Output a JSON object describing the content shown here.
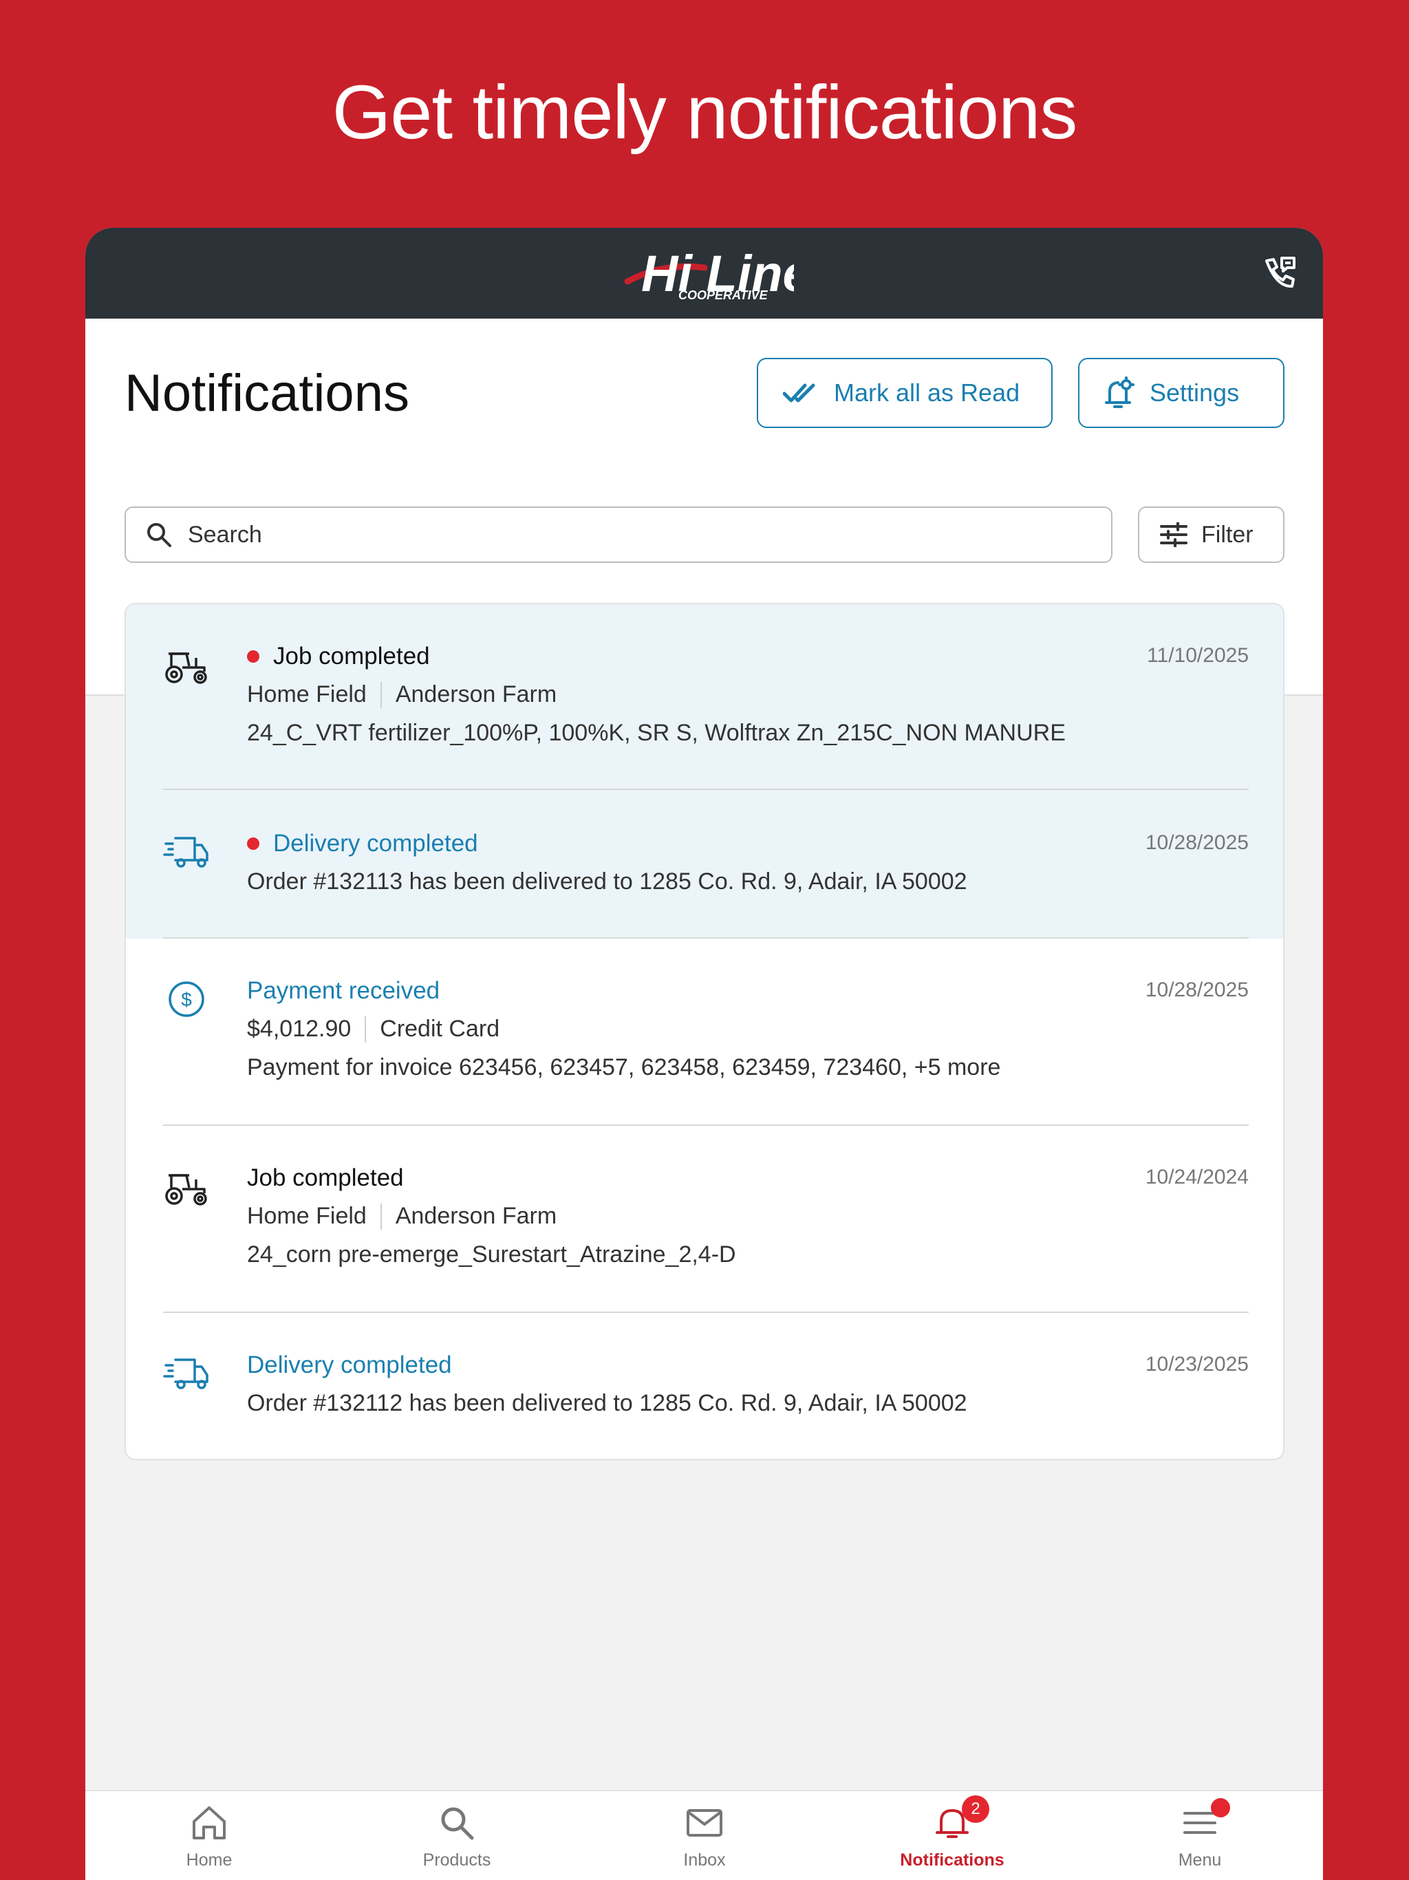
{
  "hero": {
    "headline": "Get timely notifications"
  },
  "header": {
    "logo_text": "Hi Line",
    "logo_subtext": "COOPERATIVE"
  },
  "page": {
    "title": "Notifications",
    "mark_all_label": "Mark all as Read",
    "settings_label": "Settings"
  },
  "search": {
    "placeholder": "Search",
    "filter_label": "Filter"
  },
  "notifications": [
    {
      "icon": "tractor-icon",
      "unread": true,
      "title": "Job completed",
      "date": "11/10/2025",
      "field": "Home Field",
      "farm": "Anderson Farm",
      "detail": "24_C_VRT fertilizer_100%P, 100%K, SR S, Wolftrax Zn_215C_NON MANURE"
    },
    {
      "icon": "delivery-truck-icon",
      "unread": true,
      "title": "Delivery completed",
      "date": "10/28/2025",
      "detail": "Order #132113 has been delivered to 1285 Co. Rd. 9, Adair, IA 50002"
    },
    {
      "icon": "dollar-circle-icon",
      "unread": false,
      "title": "Payment received",
      "date": "10/28/2025",
      "amount": "$4,012.90",
      "method": "Credit Card",
      "detail": "Payment for invoice 623456, 623457, 623458, 623459, 723460, +5 more"
    },
    {
      "icon": "tractor-icon",
      "unread": false,
      "title": "Job completed",
      "date": "10/24/2024",
      "field": "Home Field",
      "farm": "Anderson Farm",
      "detail": "24_corn pre-emerge_Surestart_Atrazine_2,4-D"
    },
    {
      "icon": "delivery-truck-icon",
      "unread": false,
      "title": "Delivery completed",
      "date": "10/23/2025",
      "detail": "Order #132112 has been delivered to 1285 Co. Rd. 9, Adair, IA 50002"
    }
  ],
  "tabbar": {
    "home": "Home",
    "products": "Products",
    "inbox": "Inbox",
    "notifications": "Notifications",
    "notifications_badge": "2",
    "menu": "Menu"
  },
  "colors": {
    "brand_red": "#c8202a",
    "accent_blue": "#1a7fb0",
    "unread_bg": "#ebf4f9",
    "header_dark": "#2b3238"
  }
}
